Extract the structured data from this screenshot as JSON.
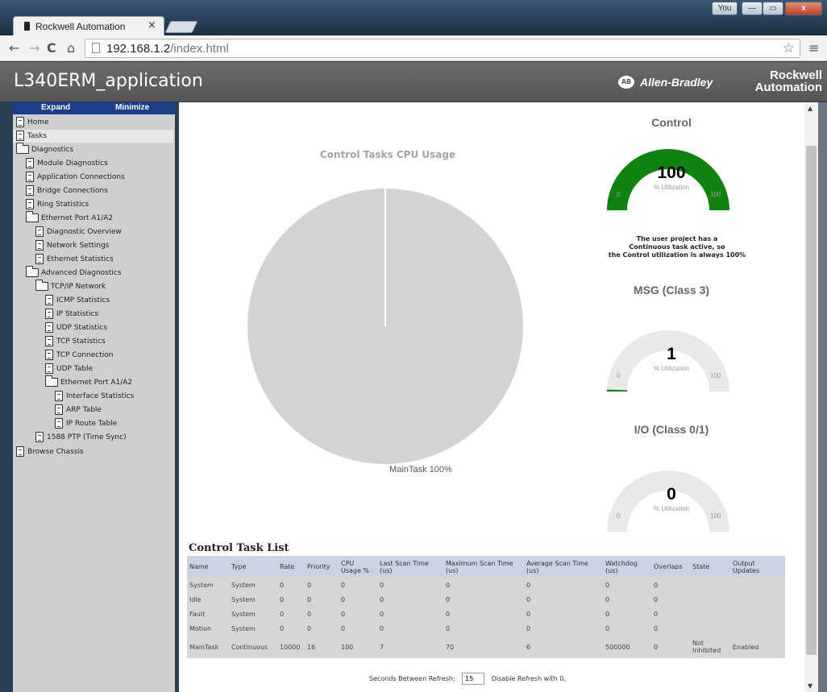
{
  "browser": {
    "tab_title": "Rockwell Automation",
    "tab_close": "×",
    "url_host": "192.168.1.2",
    "url_path": "/index.html",
    "window_user": "You",
    "window_min": "—",
    "window_max": "▭",
    "window_close": "x",
    "back_glyph": "←",
    "forward_glyph": "→",
    "reload_glyph": "C",
    "home_glyph": "⌂",
    "star_glyph": "☆",
    "menu_glyph": "≡"
  },
  "header": {
    "title": "L340ERM_application",
    "ab_badge": "AB",
    "allen_bradley": "Allen-Bradley",
    "rockwell_line1": "Rockwell",
    "rockwell_line2": "Automation"
  },
  "sidebar": {
    "expand": "Expand",
    "minimize": "Minimize",
    "items": [
      {
        "label": "Home",
        "icon": "page"
      },
      {
        "label": "Tasks",
        "icon": "page"
      },
      {
        "label": "Diagnostics",
        "icon": "folder"
      },
      {
        "label": "Module Diagnostics",
        "icon": "page"
      },
      {
        "label": "Application Connections",
        "icon": "page"
      },
      {
        "label": "Bridge Connections",
        "icon": "page"
      },
      {
        "label": "Ring Statistics",
        "icon": "page"
      },
      {
        "label": "Ethernet Port A1/A2",
        "icon": "folder"
      },
      {
        "label": "Diagnostic Overview",
        "icon": "page"
      },
      {
        "label": "Network Settings",
        "icon": "page"
      },
      {
        "label": "Ethernet Statistics",
        "icon": "page"
      },
      {
        "label": "Advanced Diagnostics",
        "icon": "folder"
      },
      {
        "label": "TCP/IP Network",
        "icon": "folder"
      },
      {
        "label": "ICMP Statistics",
        "icon": "page"
      },
      {
        "label": "IP Statistics",
        "icon": "page"
      },
      {
        "label": "UDP Statistics",
        "icon": "page"
      },
      {
        "label": "TCP Statistics",
        "icon": "page"
      },
      {
        "label": "TCP Connection",
        "icon": "page"
      },
      {
        "label": "UDP Table",
        "icon": "page"
      },
      {
        "label": "Ethernet Port A1/A2",
        "icon": "folder"
      },
      {
        "label": "Interface Statistics",
        "icon": "page"
      },
      {
        "label": "ARP Table",
        "icon": "page"
      },
      {
        "label": "IP Route Table",
        "icon": "page"
      },
      {
        "label": "1588 PTP (Time Sync)",
        "icon": "page"
      },
      {
        "label": "Browse Chassis",
        "icon": "page"
      }
    ]
  },
  "pie": {
    "title": "Control Tasks CPU Usage",
    "label": "MainTask 100%"
  },
  "gauges": {
    "control": {
      "title": "Control",
      "value": "100",
      "fraction": 1.0,
      "unit": "% Utilization",
      "min": "0",
      "max": "100",
      "color": "#118211"
    },
    "msg": {
      "title": "MSG (Class 3)",
      "value": "1",
      "fraction": 0.01,
      "unit": "% Utilization",
      "min": "0",
      "max": "100",
      "color": "#118211"
    },
    "io": {
      "title": "I/O (Class 0/1)",
      "value": "0",
      "fraction": 0.0,
      "unit": "% Utilization",
      "min": "0",
      "max": "100",
      "color": "#118211"
    }
  },
  "control_note": {
    "line1": "The user project has a",
    "line2": "Continuous task active, so",
    "line3": "the Control utilization is always 100%"
  },
  "task_list": {
    "title": "Control Task List",
    "columns": [
      "Name",
      "Type",
      "Rate",
      "Priority",
      "CPU Usage %",
      "Last Scan Time (us)",
      "Maximum Scan Time (us)",
      "Average Scan Time (us)",
      "Watchdog (us)",
      "Overlaps",
      "State",
      "Output Updates"
    ],
    "rows": [
      [
        "System",
        "System",
        "0",
        "0",
        "0",
        "0",
        "0",
        "0",
        "0",
        "0",
        "",
        ""
      ],
      [
        "Idle",
        "System",
        "0",
        "0",
        "0",
        "0",
        "0",
        "0",
        "0",
        "0",
        "",
        ""
      ],
      [
        "Fault",
        "System",
        "0",
        "0",
        "0",
        "0",
        "0",
        "0",
        "0",
        "0",
        "",
        ""
      ],
      [
        "Motion",
        "System",
        "0",
        "0",
        "0",
        "0",
        "0",
        "0",
        "0",
        "0",
        "",
        ""
      ],
      [
        "MainTask",
        "Continuous",
        "10000",
        "16",
        "100",
        "7",
        "70",
        "6",
        "500000",
        "0",
        "Not Inhibited",
        "Enabled"
      ]
    ]
  },
  "refresh": {
    "label": "Seconds Between Refresh:",
    "value": "15",
    "hint": "Disable Refresh with 0."
  },
  "colors": {
    "gauge_fill": "#118211",
    "gauge_track": "#e9e9e9",
    "pie_fill": "#d3d3d3",
    "sidebar_header": "#1c3d87"
  }
}
